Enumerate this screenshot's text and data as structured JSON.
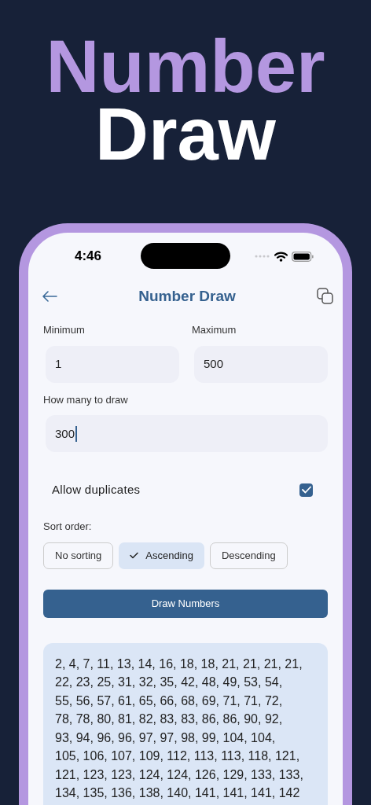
{
  "headline": {
    "line_1": "Number",
    "line_2": "Draw"
  },
  "status_bar": {
    "time": "4:46"
  },
  "nav": {
    "title": "Number Draw"
  },
  "fields": [
    {
      "label": "Minimum",
      "value": "1",
      "focused": false
    },
    {
      "label": "Maximum",
      "value": "500",
      "focused": false
    },
    {
      "label": "How many to draw",
      "value": "300",
      "focused": true
    }
  ],
  "allow_duplicates": {
    "label": "Allow duplicates",
    "checked": true
  },
  "sort": {
    "label": "Sort order:",
    "options": [
      {
        "label": "No sorting",
        "selected": false
      },
      {
        "label": "Ascending",
        "selected": true
      },
      {
        "label": "Descending",
        "selected": false
      }
    ]
  },
  "draw_button": "Draw Numbers",
  "result_lines": [
    "2, 4, 7, 11, 13, 14, 16, 18, 18, 21, 21, 21, 21,",
    "22, 23, 25, 31, 32, 35, 42, 48, 49, 53, 54,",
    "55, 56, 57, 61, 65, 66, 68, 69, 71, 71, 72,",
    "78, 78, 80, 81, 82, 83, 83, 86, 86, 90, 92,",
    "93, 94, 96, 96, 97, 97, 98, 99, 104, 104,",
    "105, 106, 107, 109, 112, 113, 113, 118, 121,",
    "121, 123, 123, 124, 124, 126, 129, 133, 133,",
    "134, 135, 136, 138, 140, 141, 141, 141, 142"
  ]
}
